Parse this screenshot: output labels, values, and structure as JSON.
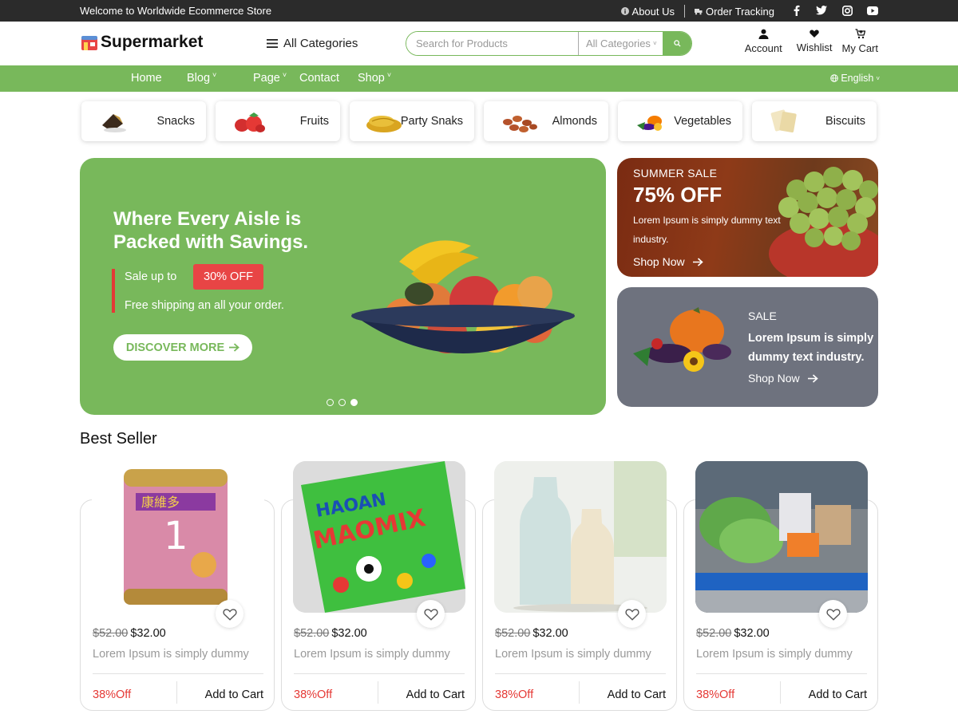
{
  "topbar": {
    "welcome": "Welcome to Worldwide Ecommerce Store",
    "about": "About Us",
    "tracking": "Order Tracking",
    "social_icons": [
      "facebook-icon",
      "twitter-icon",
      "instagram-icon",
      "youtube-icon"
    ]
  },
  "header": {
    "logo": "Supermarket",
    "all_categories": "All Categories",
    "search_placeholder": "Search for Products",
    "search_category": "All Categories",
    "account": "Account",
    "wishlist": "Wishlist",
    "cart": "My Cart"
  },
  "nav": {
    "items": [
      "Home",
      "Blog",
      "Page",
      "Contact",
      "Shop"
    ],
    "language": "English"
  },
  "categories": [
    "Snacks",
    "Fruits",
    "Party Snaks",
    "Almonds",
    "Vegetables",
    "Biscuits"
  ],
  "hero": {
    "title": "Where Every Aisle is Packed with Savings.",
    "sale_text": "Sale up to",
    "badge": "30% OFF",
    "shipping": "Free shipping an all your order.",
    "button": "DISCOVER MORE",
    "slides": 3,
    "active_slide": 3
  },
  "promo1": {
    "kicker": "SUMMER SALE",
    "headline": "75% OFF",
    "desc": "Lorem Ipsum is simply dummy text industry.",
    "link": "Shop Now"
  },
  "promo2": {
    "kicker": "SALE",
    "desc": "Lorem Ipsum is simply dummy text industry.",
    "link": "Shop Now"
  },
  "best_seller": {
    "title": "Best Seller",
    "products": [
      {
        "old_price": "$52.00",
        "price": "$32.00",
        "desc": "Lorem Ipsum is simply dummy",
        "discount": "38%Off",
        "cta": "Add to Cart"
      },
      {
        "old_price": "$52.00",
        "price": "$32.00",
        "desc": "Lorem Ipsum is simply dummy",
        "discount": "38%Off",
        "cta": "Add to Cart"
      },
      {
        "old_price": "$52.00",
        "price": "$32.00",
        "desc": "Lorem Ipsum is simply dummy",
        "discount": "38%Off",
        "cta": "Add to Cart"
      },
      {
        "old_price": "$52.00",
        "price": "$32.00",
        "desc": "Lorem Ipsum is simply dummy",
        "discount": "38%Off",
        "cta": "Add to Cart"
      }
    ]
  },
  "colors": {
    "brand_green": "#78b85b",
    "topbar": "#2b2b2b",
    "sale_red": "#e84545",
    "promo_gray": "#6e727e"
  }
}
